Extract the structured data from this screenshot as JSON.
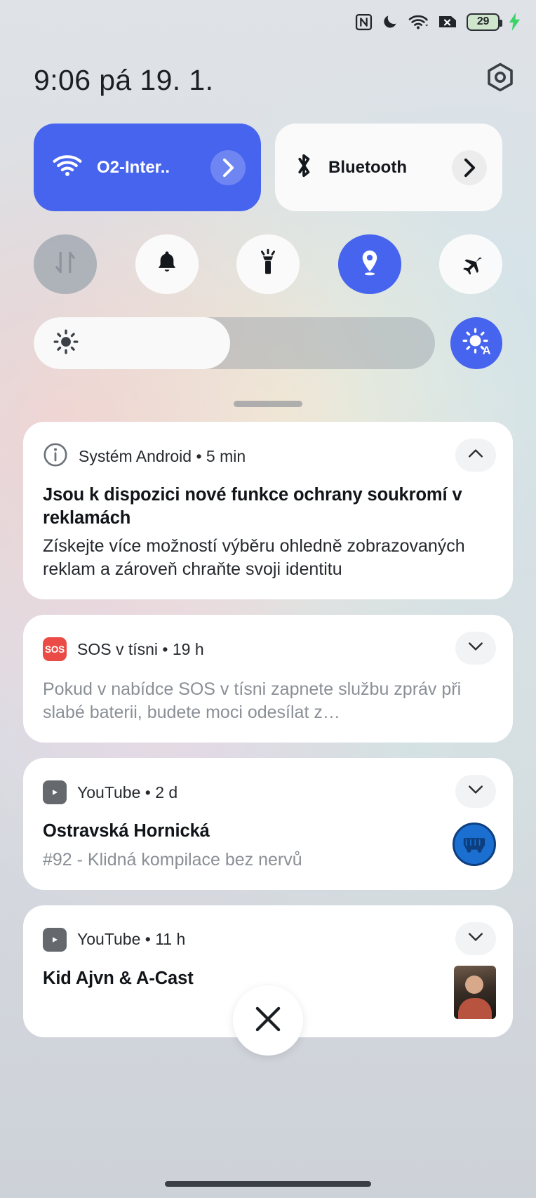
{
  "statusbar": {
    "icons": [
      "nfc-icon",
      "do-not-disturb-icon",
      "wifi-icon",
      "no-sim-icon"
    ],
    "battery_percent": "29",
    "charging": true
  },
  "header": {
    "clock": "9:06  pá 19. 1.",
    "settings_label": "settings-icon"
  },
  "quick_settings": {
    "big_tiles": [
      {
        "name": "wifi",
        "label": "O2-Inter..",
        "icon": "wifi-icon",
        "active": true
      },
      {
        "name": "bluetooth",
        "label": "Bluetooth",
        "icon": "bluetooth-icon",
        "active": false
      }
    ],
    "toggles": [
      {
        "name": "mobile-data",
        "icon": "data-transfer-icon",
        "state": "disabled"
      },
      {
        "name": "sound",
        "icon": "bell-icon",
        "state": "off"
      },
      {
        "name": "flashlight",
        "icon": "flashlight-icon",
        "state": "off"
      },
      {
        "name": "location",
        "icon": "location-pin-icon",
        "state": "on"
      },
      {
        "name": "airplane-mode",
        "icon": "airplane-icon",
        "state": "off"
      }
    ],
    "brightness": {
      "icon": "brightness-icon",
      "value_percent": 49,
      "auto_label": "auto-brightness-icon",
      "auto_active": true
    }
  },
  "notifications": [
    {
      "app": "Systém Android • 5 min",
      "icon": "info-icon",
      "expanded": true,
      "expand_icon": "chevron-up-icon",
      "title": "Jsou k dispozici nové funkce ochrany soukromí v reklamách",
      "body": "Získejte více možností výběru ohledně zobrazovaných reklam a zároveň chraňte svoji identitu"
    },
    {
      "app": "SOS v tísni • 19 h",
      "icon": "sos-icon",
      "icon_text": "SOS",
      "expanded": false,
      "expand_icon": "chevron-down-icon",
      "body": "Pokud v nabídce SOS v tísni zapnete službu zpráv při slabé baterii, budete moci odesílat z…"
    },
    {
      "app": "YouTube • 2 d",
      "icon": "youtube-icon",
      "expanded": false,
      "expand_icon": "chevron-down-icon",
      "title": "Ostravská Hornická",
      "body": "#92 - Klidná kompilace bez nervů",
      "thumbnail": "mining-cart-avatar"
    },
    {
      "app": "YouTube • 11 h",
      "icon": "youtube-icon",
      "expanded": false,
      "expand_icon": "chevron-down-icon",
      "title": "Kid Ajvn & A-Cast",
      "thumbnail": "video-photo-thumbnail"
    }
  ],
  "close_button": {
    "name": "clear-all-notifications",
    "icon": "close-icon"
  },
  "colors": {
    "accent": "#4764ef",
    "sos_red": "#eb4b46",
    "card": "#ffffff",
    "text": "#111418",
    "muted": "#8a8f96"
  }
}
